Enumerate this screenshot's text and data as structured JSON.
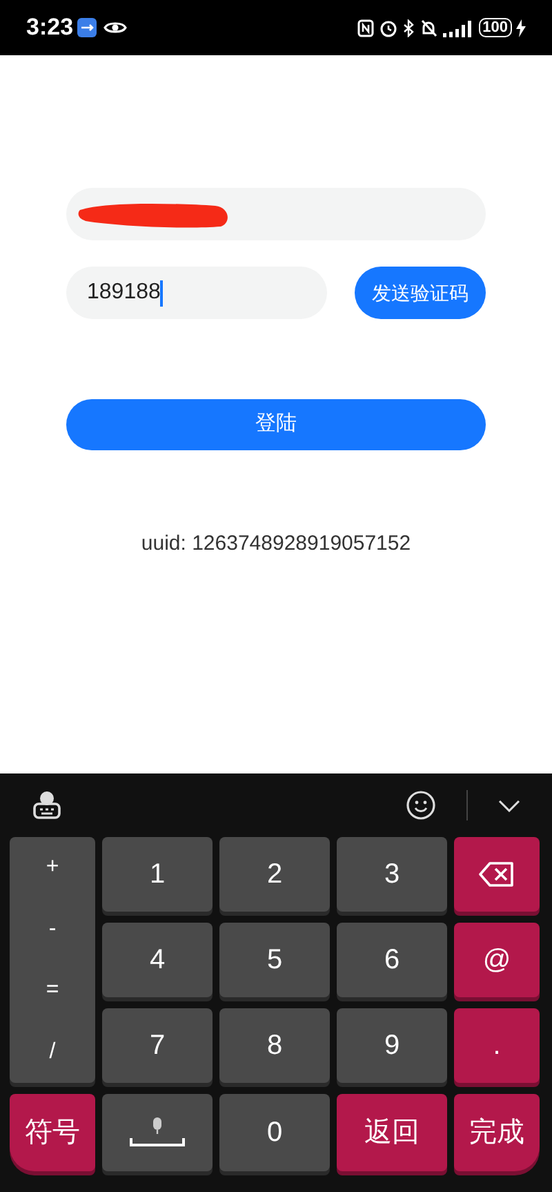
{
  "status_bar": {
    "time": "3:23",
    "battery": "100"
  },
  "phone_field": {
    "redacted": true
  },
  "code_field": {
    "value": "189188",
    "focused": true
  },
  "send_code_button": {
    "label": "发送验证码"
  },
  "login_button": {
    "label": "登陆"
  },
  "uuid_text": "uuid: 1263748928919057152",
  "keyboard": {
    "keys": [
      {
        "kind": "stack",
        "symbols": [
          "+",
          "-",
          "=",
          "/"
        ],
        "accent": false
      },
      {
        "kind": "text",
        "label": "1",
        "accent": false
      },
      {
        "kind": "text",
        "label": "2",
        "accent": false
      },
      {
        "kind": "text",
        "label": "3",
        "accent": false
      },
      {
        "kind": "backspace",
        "accent": true
      },
      {
        "kind": "text",
        "label": "4",
        "accent": false
      },
      {
        "kind": "text",
        "label": "5",
        "accent": false
      },
      {
        "kind": "text",
        "label": "6",
        "accent": false
      },
      {
        "kind": "text",
        "label": "@",
        "accent": true
      },
      {
        "kind": "text",
        "label": "7",
        "accent": false
      },
      {
        "kind": "text",
        "label": "8",
        "accent": false
      },
      {
        "kind": "text",
        "label": "9",
        "accent": false
      },
      {
        "kind": "text",
        "label": ".",
        "accent": true
      },
      {
        "kind": "text",
        "label": "符号",
        "accent": true
      },
      {
        "kind": "space",
        "accent": false
      },
      {
        "kind": "text",
        "label": "0",
        "accent": false
      },
      {
        "kind": "text",
        "label": "返回",
        "accent": true
      },
      {
        "kind": "text",
        "label": "完成",
        "accent": true
      }
    ]
  }
}
